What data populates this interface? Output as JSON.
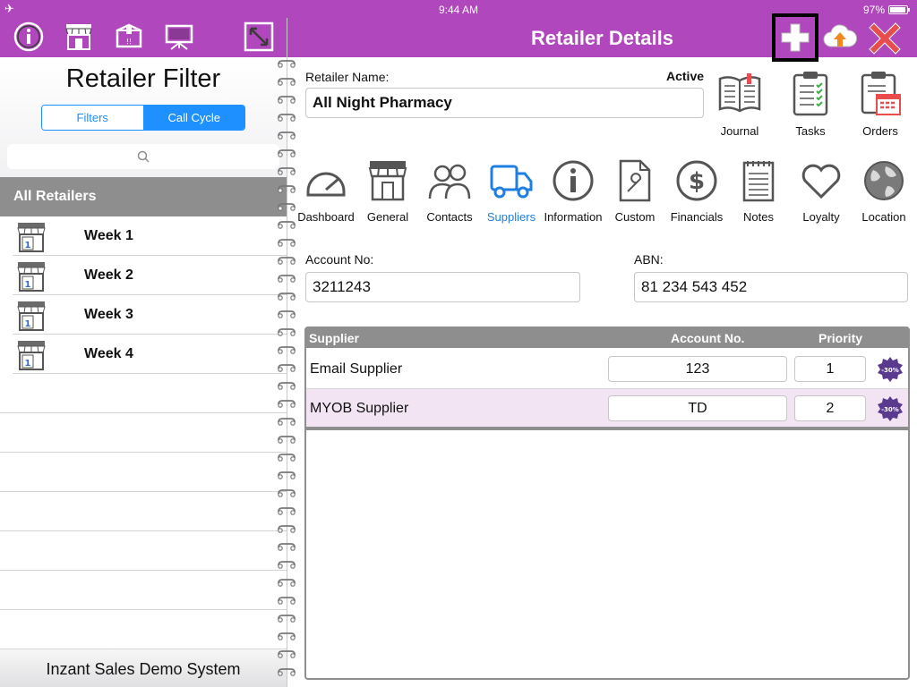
{
  "status_bar": {
    "time": "9:44 AM",
    "battery": "97%"
  },
  "left": {
    "title": "Retailer Filter",
    "segments": {
      "filters": "Filters",
      "call_cycle": "Call Cycle"
    },
    "search_placeholder": "",
    "section": "All Retailers",
    "weeks": [
      "Week 1",
      "Week 2",
      "Week 3",
      "Week 4"
    ],
    "footer": "Inzant Sales Demo System"
  },
  "right": {
    "title": "Retailer Details",
    "retailer_name_label": "Retailer Name:",
    "status": "Active",
    "retailer_name": "All Night Pharmacy",
    "top_tiles": [
      "Journal",
      "Tasks",
      "Orders"
    ],
    "tabs": [
      "Dashboard",
      "General",
      "Contacts",
      "Suppliers",
      "Information",
      "Custom",
      "Financials",
      "Notes",
      "Loyalty",
      "Location"
    ],
    "active_tab": "Suppliers",
    "account_label": "Account No:",
    "account_value": "3211243",
    "abn_label": "ABN:",
    "abn_value": "81 234 543 452",
    "table": {
      "headers": {
        "supplier": "Supplier",
        "account": "Account No.",
        "priority": "Priority"
      },
      "rows": [
        {
          "supplier": "Email Supplier",
          "account": "123",
          "priority": "1",
          "badge": "-30%"
        },
        {
          "supplier": "MYOB Supplier",
          "account": "TD",
          "priority": "2",
          "badge": "-30%"
        }
      ]
    }
  },
  "icons": {
    "header_left": [
      "info-icon",
      "store-icon",
      "box-icon",
      "presentation-icon",
      "expand-icon"
    ],
    "header_right": [
      "add-icon",
      "cloud-upload-icon",
      "close-icon"
    ]
  },
  "colors": {
    "header": "#b047bd",
    "accent": "#1e90ff",
    "close": "#e84c4c",
    "upload": "#f08a1e",
    "row_alt": "#f3e4f3",
    "badge": "#5a3a8e"
  }
}
